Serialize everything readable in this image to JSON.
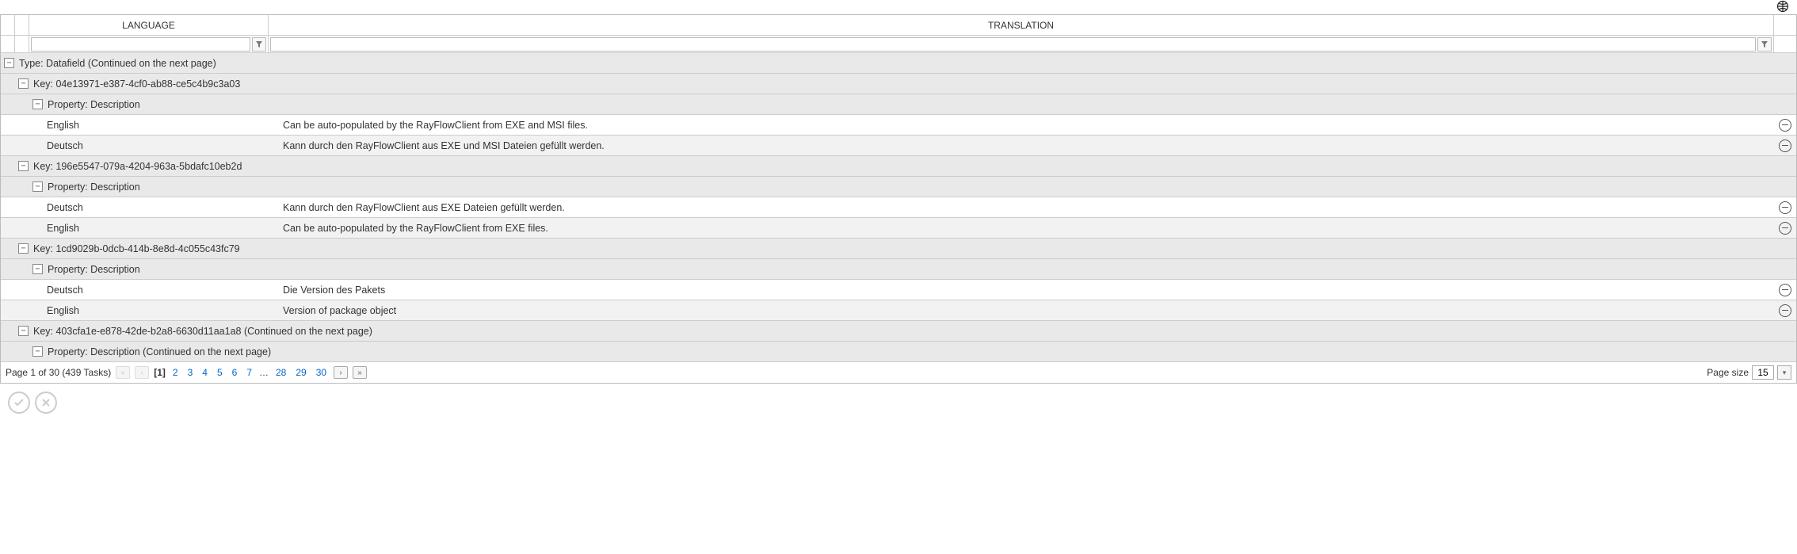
{
  "headers": {
    "language": "LANGUAGE",
    "translation": "TRANSLATION"
  },
  "filters": {
    "language": "",
    "translation": ""
  },
  "groups": {
    "type": "Type: Datafield (Continued on the next page)",
    "key1": {
      "label": "Key: 04e13971-e387-4cf0-ab88-ce5c4b9c3a03",
      "prop": "Property: Description",
      "rows": [
        {
          "lang": "English",
          "trans": "Can be auto-populated by the RayFlowClient from EXE and MSI files."
        },
        {
          "lang": "Deutsch",
          "trans": "Kann durch den RayFlowClient aus EXE und MSI Dateien gefüllt werden."
        }
      ]
    },
    "key2": {
      "label": "Key: 196e5547-079a-4204-963a-5bdafc10eb2d",
      "prop": "Property: Description",
      "rows": [
        {
          "lang": "Deutsch",
          "trans": "Kann durch den RayFlowClient aus EXE Dateien gefüllt werden."
        },
        {
          "lang": "English",
          "trans": "Can be auto-populated by the RayFlowClient from EXE files."
        }
      ]
    },
    "key3": {
      "label": "Key: 1cd9029b-0dcb-414b-8e8d-4c055c43fc79",
      "prop": "Property: Description",
      "rows": [
        {
          "lang": "Deutsch",
          "trans": "Die Version des Pakets"
        },
        {
          "lang": "English",
          "trans": "Version of package object"
        }
      ]
    },
    "key4": {
      "label": "Key: 403cfa1e-e878-42de-b2a8-6630d11aa1a8 (Continued on the next page)",
      "prop": "Property: Description (Continued on the next page)"
    }
  },
  "pager": {
    "summary": "Page 1 of 30 (439 Tasks)",
    "current": "[1]",
    "pages": [
      "2",
      "3",
      "4",
      "5",
      "6",
      "7"
    ],
    "ellipsis": "…",
    "last_pages": [
      "28",
      "29",
      "30"
    ],
    "size_label": "Page size",
    "size_value": "15"
  }
}
